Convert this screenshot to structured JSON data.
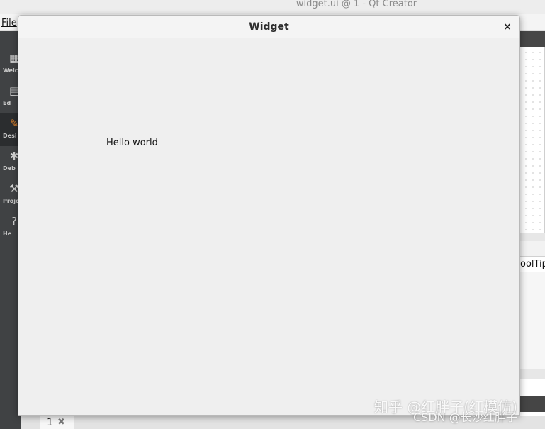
{
  "background_app": {
    "title": "widget.ui @ 1 - Qt Creator",
    "menu": {
      "file_label": "File"
    },
    "sidebar": {
      "modes": [
        {
          "label": "Welcome",
          "visible_label": "Welc",
          "icon": "grid-icon",
          "active": false
        },
        {
          "label": "Edit",
          "visible_label": "Ed",
          "icon": "document-icon",
          "active": false
        },
        {
          "label": "Design",
          "visible_label": "Desi",
          "icon": "pencil-icon",
          "active": true
        },
        {
          "label": "Debug",
          "visible_label": "Deb",
          "icon": "bug-icon",
          "active": false
        },
        {
          "label": "Projects",
          "visible_label": "Proje",
          "icon": "wrench-icon",
          "active": false
        },
        {
          "label": "Help",
          "visible_label": "He",
          "icon": "help-icon",
          "active": false
        }
      ]
    },
    "property_editor": {
      "visible_property": "oolTip"
    },
    "output_pane": {
      "tab_number": "1",
      "tab_close": "✖"
    }
  },
  "widget_window": {
    "title": "Widget",
    "close_glyph": "×",
    "label_text": "Hello world"
  },
  "watermark": {
    "line1": "知乎 @红胖子(红模仿)",
    "line2": "CSDN @长沙红胖子"
  },
  "colors": {
    "sidebar": "#404244",
    "active_mode_accent": "#e8862a",
    "window_bg": "#efefef"
  }
}
